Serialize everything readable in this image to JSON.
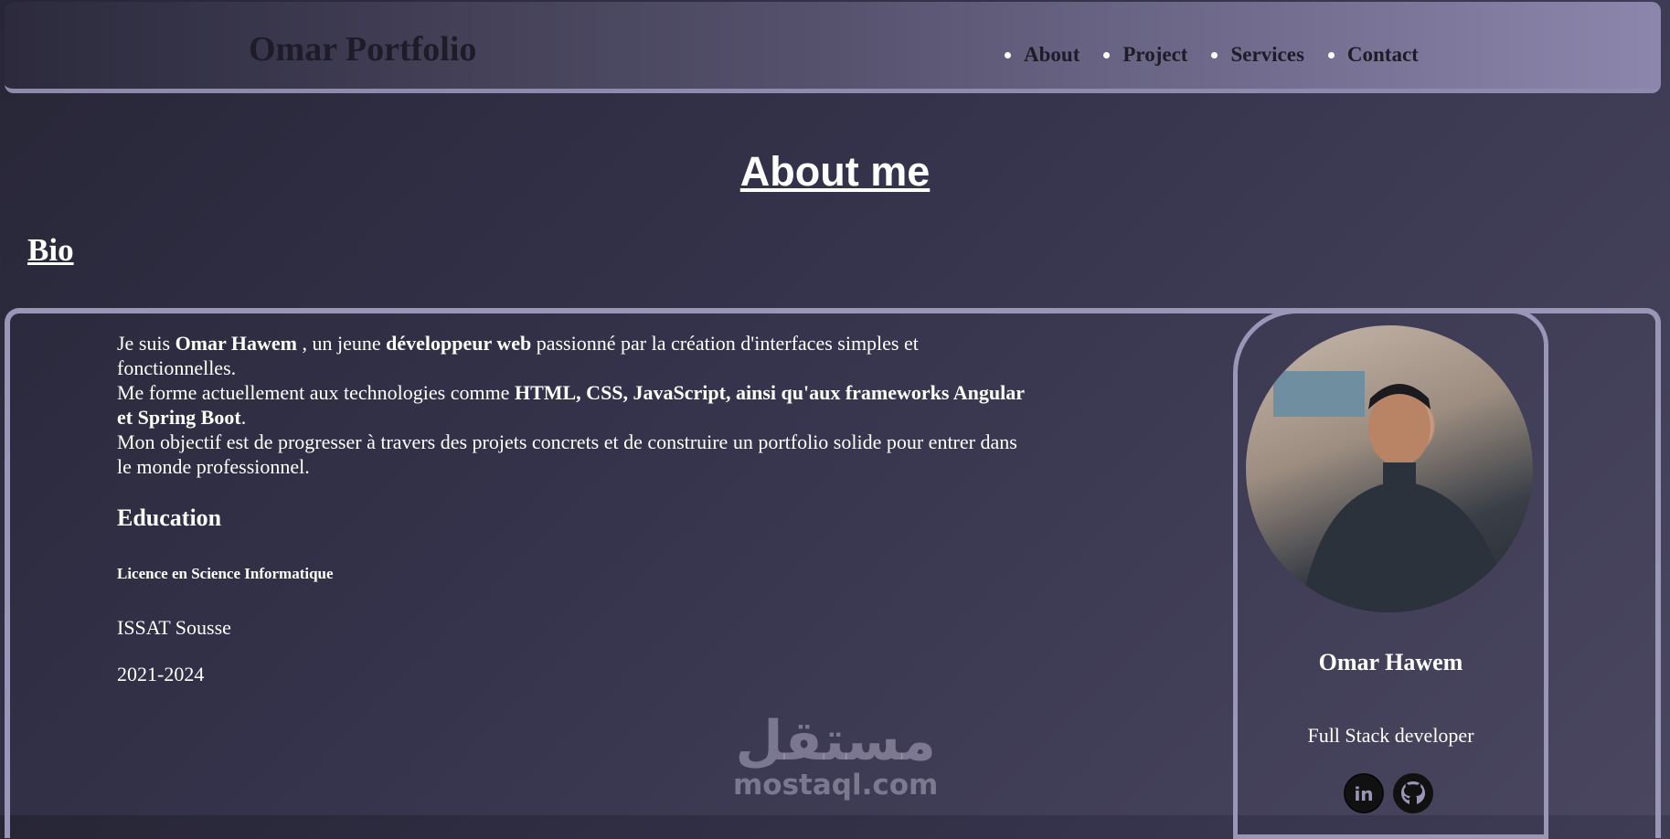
{
  "header": {
    "logo": "Omar Portfolio",
    "nav": [
      {
        "label": "About"
      },
      {
        "label": "Project"
      },
      {
        "label": "Services"
      },
      {
        "label": "Contact"
      }
    ]
  },
  "page_title": "About me",
  "bio": {
    "title": "Bio",
    "line1_pre": "Je suis ",
    "line1_name": "Omar Hawem",
    "line1_mid": " , un jeune ",
    "line1_role": "développeur web",
    "line1_post": " passionné par la création d'interfaces simples et fonctionnelles.",
    "line2_pre": "Me forme actuellement aux technologies comme ",
    "line2_tech": "HTML, CSS, JavaScript, ainsi qu'aux frameworks Angular et Spring Boot",
    "line2_post": ".",
    "line3": "Mon objectif est de progresser à travers des projets concrets et de construire un portfolio solide pour entrer dans le monde professionnel."
  },
  "education": {
    "title": "Education",
    "degree": "Licence en Science Informatique",
    "school": "ISSAT Sousse",
    "years": "2021-2024"
  },
  "profile": {
    "name": "Omar Hawem",
    "role": "Full Stack developer",
    "social": [
      {
        "icon": "linkedin-icon",
        "label": "in"
      },
      {
        "icon": "github-icon"
      }
    ]
  },
  "watermark": {
    "arabic": "مستقل",
    "latin": "mostaql.com"
  }
}
